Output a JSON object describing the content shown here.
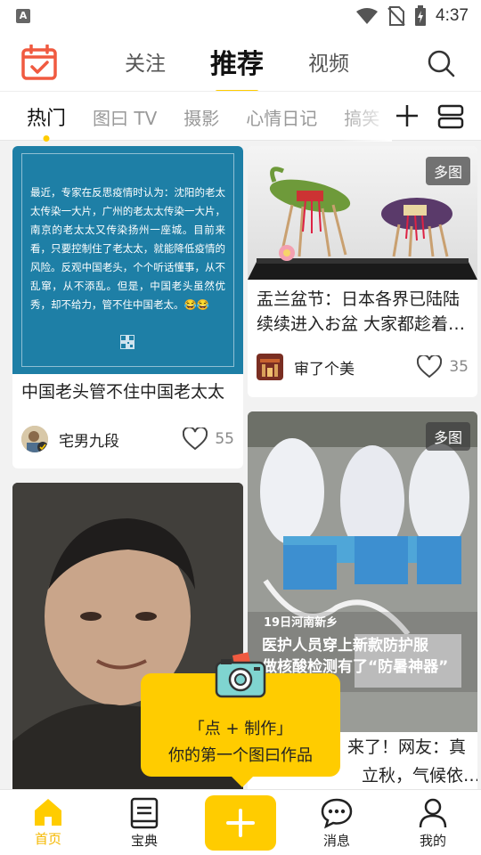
{
  "status_bar": {
    "time": "4:37",
    "left_badge": "A"
  },
  "top_nav": {
    "tabs": [
      "关注",
      "推荐",
      "视频"
    ],
    "active_tab": "推荐"
  },
  "categories": {
    "items": [
      "热门",
      "图曰 TV",
      "摄影",
      "心情日记",
      "搞笑"
    ],
    "active": "热门"
  },
  "feed": {
    "card1": {
      "image_text": "最近，专家在反思疫情时认为：沈阳的老太太传染一大片，广州的老太太传染一大片，南京的老太太又传染扬州一座城。目前来看，只要控制住了老太太，就能降低疫情的风险。反观中国老头，个个听话懂事，从不乱窜，从不添乱。但是，中国老头虽然优秀，却不给力，管不住中国老太。😂😂",
      "title": "中国老头管不住中国老太太",
      "author": "宅男九段",
      "likes": "55"
    },
    "card2": {
      "badge": "多图",
      "title": "盂兰盆节：日本各界已陆陆续续进入お盆 大家都趁着…",
      "author": "审了个美",
      "likes": "35"
    },
    "card3": {
      "badge": "多图",
      "overlay_small": "19日河南新乡",
      "overlay_line1": "医护人员穿上新款防护服",
      "overlay_line2": "做核酸检测有了“防暑神器”",
      "title_line1": "来了！网友：真",
      "title_line2": "立秋，气候依…"
    }
  },
  "tooltip": {
    "line1": "「点 + 制作」",
    "line2": "你的第一个图曰作品"
  },
  "bottom_nav": {
    "home": "首页",
    "guide": "宝典",
    "messages": "消息",
    "mine": "我的"
  },
  "colors": {
    "accent": "#ffcc00",
    "calendar_red": "#f05a40",
    "card1_bg": "#1e7fa6"
  }
}
